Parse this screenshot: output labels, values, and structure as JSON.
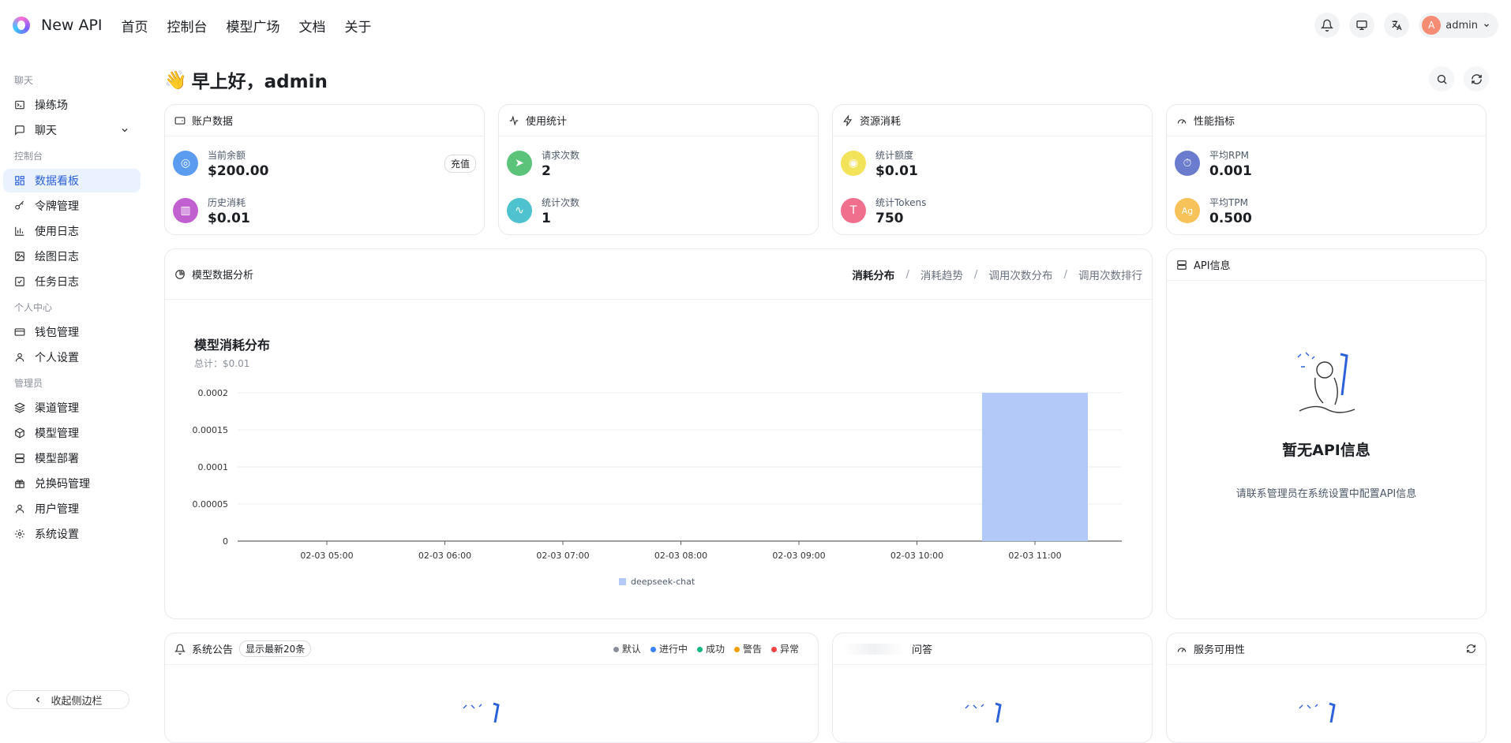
{
  "app": {
    "brand": "New API",
    "nav": [
      "首页",
      "控制台",
      "模型广场",
      "文档",
      "关于"
    ],
    "user": {
      "initial": "A",
      "name": "admin"
    }
  },
  "sidebar": {
    "groups": [
      {
        "title": "聊天",
        "items": [
          {
            "label": "操练场",
            "icon": "terminal-icon"
          },
          {
            "label": "聊天",
            "icon": "message-icon",
            "expandable": true
          }
        ]
      },
      {
        "title": "控制台",
        "items": [
          {
            "label": "数据看板",
            "icon": "dashboard-icon",
            "active": true
          },
          {
            "label": "令牌管理",
            "icon": "key-icon"
          },
          {
            "label": "使用日志",
            "icon": "bar-chart-icon"
          },
          {
            "label": "绘图日志",
            "icon": "image-icon"
          },
          {
            "label": "任务日志",
            "icon": "checkbox-icon"
          }
        ]
      },
      {
        "title": "个人中心",
        "items": [
          {
            "label": "钱包管理",
            "icon": "wallet-icon"
          },
          {
            "label": "个人设置",
            "icon": "user-icon"
          }
        ]
      },
      {
        "title": "管理员",
        "items": [
          {
            "label": "渠道管理",
            "icon": "layers-icon"
          },
          {
            "label": "模型管理",
            "icon": "cube-icon"
          },
          {
            "label": "模型部署",
            "icon": "server-icon"
          },
          {
            "label": "兑换码管理",
            "icon": "gift-icon"
          },
          {
            "label": "用户管理",
            "icon": "user-icon"
          },
          {
            "label": "系统设置",
            "icon": "gear-icon"
          }
        ]
      }
    ],
    "collapse_label": "收起侧边栏"
  },
  "greeting": {
    "emoji": "👋",
    "text": "早上好，admin"
  },
  "cards": {
    "account": {
      "title": "账户数据",
      "balance_label": "当前余额",
      "balance": "$200.00",
      "recharge": "充值",
      "spent_label": "历史消耗",
      "spent": "$0.01"
    },
    "usage": {
      "title": "使用统计",
      "req_label": "请求次数",
      "req": "2",
      "count_label": "统计次数",
      "count": "1"
    },
    "resource": {
      "title": "资源消耗",
      "quota_label": "统计额度",
      "quota": "$0.01",
      "tokens_label": "统计Tokens",
      "tokens": "750"
    },
    "perf": {
      "title": "性能指标",
      "rpm_label": "平均RPM",
      "rpm": "0.001",
      "tpm_label": "平均TPM",
      "tpm": "0.500"
    }
  },
  "analysis": {
    "title": "模型数据分析",
    "tabs": [
      "消耗分布",
      "消耗趋势",
      "调用次数分布",
      "调用次数排行"
    ],
    "active_tab": 0
  },
  "chart_data": {
    "type": "bar",
    "title": "模型消耗分布",
    "subtitle": "总计：$0.01",
    "categories": [
      "02-03 05:00",
      "02-03 06:00",
      "02-03 07:00",
      "02-03 08:00",
      "02-03 09:00",
      "02-03 10:00",
      "02-03 11:00"
    ],
    "series": [
      {
        "name": "deepseek-chat",
        "values": [
          0,
          0,
          0,
          0,
          0,
          0,
          0.0002
        ],
        "color": "#b3c9f7"
      }
    ],
    "ylim": [
      0,
      0.0002
    ],
    "yticks": [
      "0.0002",
      "0.00015",
      "0.0001",
      "0.00005",
      "0"
    ],
    "legend_position": "bottom"
  },
  "api_info": {
    "title": "API信息",
    "empty_title": "暂无API信息",
    "empty_sub": "请联系管理员在系统设置中配置API信息"
  },
  "announcements": {
    "title": "系统公告",
    "badge": "显示最新20条",
    "legend": [
      {
        "label": "默认",
        "color": "#8a8f99"
      },
      {
        "label": "进行中",
        "color": "#3b82f6"
      },
      {
        "label": "成功",
        "color": "#10b981"
      },
      {
        "label": "警告",
        "color": "#f59e0b"
      },
      {
        "label": "异常",
        "color": "#ef4444"
      }
    ]
  },
  "faq": {
    "title": "问答"
  },
  "availability": {
    "title": "服务可用性"
  }
}
